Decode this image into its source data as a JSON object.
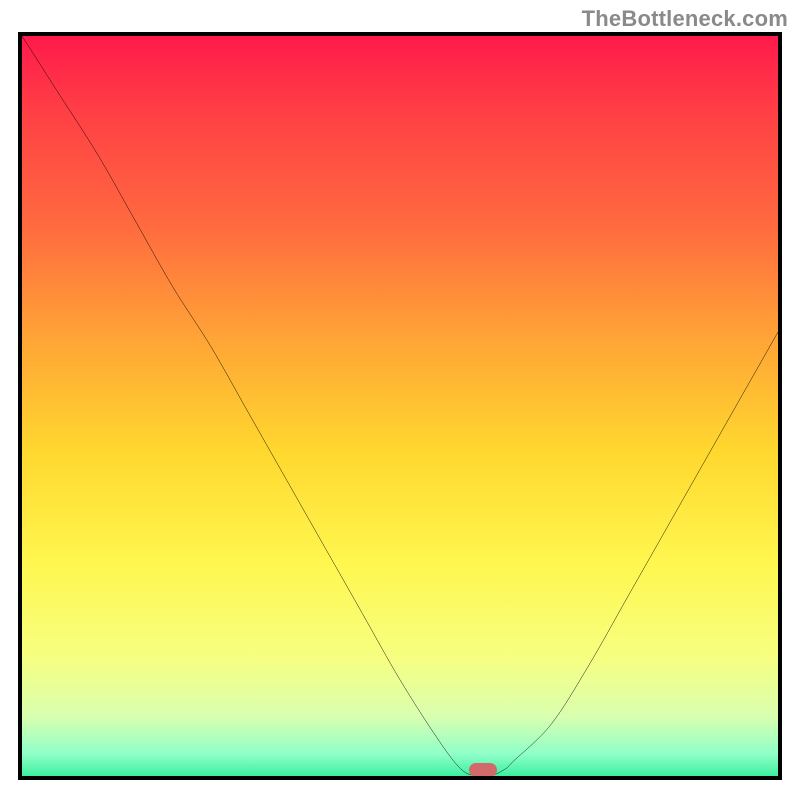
{
  "watermark": "TheBottleneck.com",
  "chart_data": {
    "type": "line",
    "title": "",
    "xlabel": "",
    "ylabel": "",
    "xlim": [
      0,
      100
    ],
    "ylim": [
      100,
      0
    ],
    "x": [
      0,
      5,
      10,
      15,
      20,
      25,
      30,
      35,
      40,
      45,
      50,
      55,
      58,
      60,
      62,
      64,
      65,
      70,
      75,
      80,
      85,
      90,
      95,
      100
    ],
    "y": [
      0,
      8,
      16,
      25,
      34,
      42,
      51,
      60,
      69,
      78,
      87,
      95,
      99,
      100,
      100,
      99,
      98,
      93,
      85,
      76,
      67,
      58,
      49,
      40
    ],
    "minimum_marker": {
      "x": 61,
      "y": 99.2
    },
    "gradient_stops": [
      {
        "offset": 0.0,
        "color": "#ff1a4b"
      },
      {
        "offset": 0.1,
        "color": "#ff3f45"
      },
      {
        "offset": 0.25,
        "color": "#ff6a3f"
      },
      {
        "offset": 0.4,
        "color": "#ffa436"
      },
      {
        "offset": 0.55,
        "color": "#ffd82e"
      },
      {
        "offset": 0.7,
        "color": "#fff750"
      },
      {
        "offset": 0.82,
        "color": "#f7ff80"
      },
      {
        "offset": 0.9,
        "color": "#d9ffb0"
      },
      {
        "offset": 0.95,
        "color": "#8fffc8"
      },
      {
        "offset": 1.0,
        "color": "#00e383"
      }
    ]
  }
}
